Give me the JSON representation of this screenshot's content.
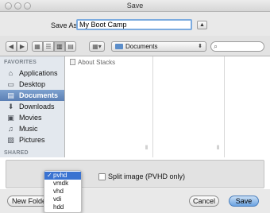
{
  "window": {
    "title": "Save"
  },
  "save_as": {
    "label": "Save As:",
    "value": "My Boot Camp"
  },
  "toolbar": {
    "back_glyph": "◀",
    "forward_glyph": "▶",
    "view_icons": "▦",
    "view_list": "☰",
    "view_columns": "▥",
    "view_coverflow": "▤",
    "arrange": "▦▾",
    "location": "Documents",
    "location_arrows": "⬍"
  },
  "sidebar": {
    "favorites_header": "FAVORITES",
    "shared_header": "SHARED",
    "items": [
      {
        "label": "Applications",
        "icon": "⌂"
      },
      {
        "label": "Desktop",
        "icon": "▭"
      },
      {
        "label": "Documents",
        "icon": "▤"
      },
      {
        "label": "Downloads",
        "icon": "⬇"
      },
      {
        "label": "Movies",
        "icon": "▣"
      },
      {
        "label": "Music",
        "icon": "♫"
      },
      {
        "label": "Pictures",
        "icon": "▨"
      }
    ]
  },
  "browser": {
    "items": [
      "About Stacks"
    ]
  },
  "accessory": {
    "split_label": "Split image (PVHD only)"
  },
  "format_menu": {
    "options": [
      "pvhd",
      "vmdk",
      "vhd",
      "vdi",
      "hdd"
    ],
    "selected": "pvhd",
    "checkmark": "✓"
  },
  "buttons": {
    "new_folder": "New Folder",
    "cancel": "Cancel",
    "save": "Save"
  },
  "colors": {
    "accent": "#3a73d1",
    "sidebar_selected": "#5b7fb4"
  }
}
